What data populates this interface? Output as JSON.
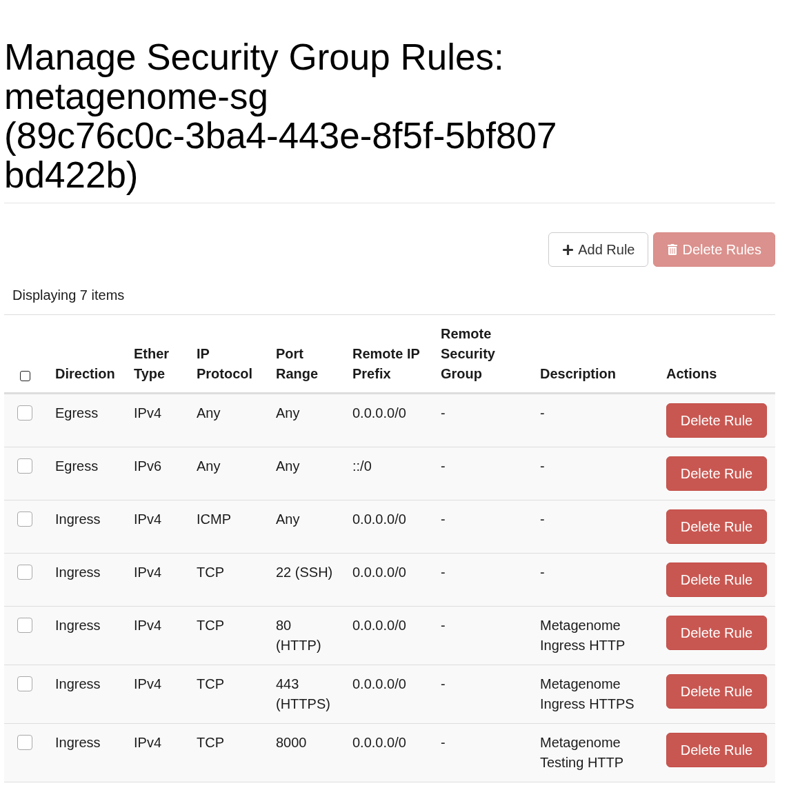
{
  "heading": {
    "title": "Manage Security Group Rules: metagenome-sg",
    "group_id": "(89c76c0c-3ba4-443e-8f5f-5bf807bd422b)"
  },
  "toolbar": {
    "buttons": [
      {
        "kind": "add",
        "label": "Add Rule",
        "disabled": false
      },
      {
        "kind": "delete",
        "label": "Delete Rules",
        "disabled": true
      }
    ]
  },
  "summary": "Displaying 7 items",
  "table": {
    "select_all": {
      "checked": false
    },
    "columns": [
      "Direction",
      "Ether Type",
      "IP Protocol",
      "Port Range",
      "Remote IP Prefix",
      "Remote Security Group",
      "Description",
      "Actions"
    ],
    "rows": [
      {
        "checked": false,
        "cells": [
          "Egress",
          "IPv4",
          "Any",
          "Any",
          "0.0.0.0/0",
          "-",
          "-"
        ],
        "action": "Delete Rule"
      },
      {
        "checked": false,
        "cells": [
          "Egress",
          "IPv6",
          "Any",
          "Any",
          "::/0",
          "-",
          "-"
        ],
        "action": "Delete Rule"
      },
      {
        "checked": false,
        "cells": [
          "Ingress",
          "IPv4",
          "ICMP",
          "Any",
          "0.0.0.0/0",
          "-",
          "-"
        ],
        "action": "Delete Rule"
      },
      {
        "checked": false,
        "cells": [
          "Ingress",
          "IPv4",
          "TCP",
          "22 (SSH)",
          "0.0.0.0/0",
          "-",
          "-"
        ],
        "action": "Delete Rule"
      },
      {
        "checked": false,
        "cells": [
          "Ingress",
          "IPv4",
          "TCP",
          "80 (HTTP)",
          "0.0.0.0/0",
          "-",
          "Metagenome Ingress HTTP"
        ],
        "action": "Delete Rule"
      },
      {
        "checked": false,
        "cells": [
          "Ingress",
          "IPv4",
          "TCP",
          "443 (HTTPS)",
          "0.0.0.0/0",
          "-",
          "Metagenome Ingress HTTPS"
        ],
        "action": "Delete Rule"
      },
      {
        "checked": false,
        "cells": [
          "Ingress",
          "IPv4",
          "TCP",
          "8000",
          "0.0.0.0/0",
          "-",
          "Metagenome Testing HTTP"
        ],
        "action": "Delete Rule"
      }
    ]
  }
}
